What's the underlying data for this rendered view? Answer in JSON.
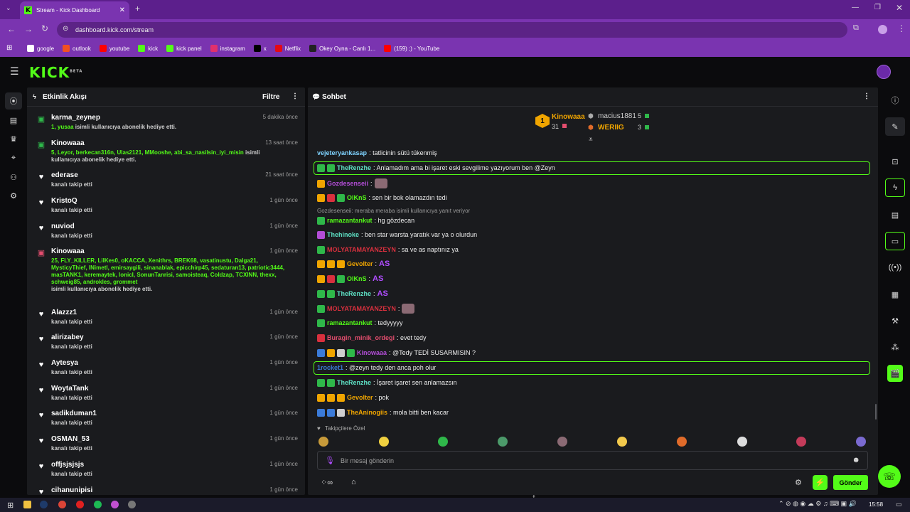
{
  "browser": {
    "tab_title": "Stream - Kick Dashboard",
    "url": "dashboard.kick.com/stream",
    "bookmarks": [
      {
        "label": "google",
        "color": "#ffffff"
      },
      {
        "label": "outlook",
        "color": "#f25022"
      },
      {
        "label": "youtube",
        "color": "#ff0000"
      },
      {
        "label": "kick",
        "color": "#53fc18"
      },
      {
        "label": "kick panel",
        "color": "#53fc18"
      },
      {
        "label": "instagram",
        "color": "#e1306c"
      },
      {
        "label": "x",
        "color": "#000000"
      },
      {
        "label": "Netflix",
        "color": "#e50914"
      },
      {
        "label": "Okey Oyna - Canlı 1...",
        "color": "#222222"
      },
      {
        "label": "(159) ;) - YouTube",
        "color": "#ff0000"
      }
    ]
  },
  "app": {
    "logo": "KICK",
    "logo_badge": "BETA"
  },
  "activity": {
    "title": "Etkinlik Akışı",
    "filter_label": "Filtre",
    "events": [
      {
        "icon": "gift-icon",
        "name": "karma_zeynep",
        "time": "5 dakika önce",
        "highlight": "1, yusaa",
        "text": " isimli kullanıcıya abonelik hediye etti."
      },
      {
        "icon": "gift-icon",
        "name": "Kinowaaa",
        "time": "13 saat önce",
        "highlight": "5, Leyor, berkecan316n, Ulas2121, MMooshe, abi_sa_nasilsin_iyi_misin",
        "text": " isimli kullanıcıya abonelik hediye etti."
      },
      {
        "icon": "heart-icon",
        "name": "ederase",
        "time": "21 saat önce",
        "highlight": "",
        "text": "kanalı takip etti"
      },
      {
        "icon": "heart-icon",
        "name": "KristoQ",
        "time": "1 gün önce",
        "highlight": "",
        "text": "kanalı takip etti"
      },
      {
        "icon": "heart-icon",
        "name": "nuviod",
        "time": "1 gün önce",
        "highlight": "",
        "text": "kanalı takip etti"
      },
      {
        "icon": "gift-icon",
        "name": "Kinowaaa",
        "time": "1 gün önce",
        "highlight": "25, FLY_KILLER, LilKes0, oKACCA, Xenithrs, BREK68, vasatinustu, Dalga21, MysticyThief, INimetI, emirsaygili, sinanablak, epicchirp45, sedaturan13, patriotic3444, masTANK1, keremaytek, lonicI, SonunTanrisi, samoisteaq, Coldzap, TCXINN, thexx, schweig85, androkles, grommet",
        "text": "isimli kullanıcıya abonelik hediye etti."
      },
      {
        "icon": "heart-icon",
        "name": "Alazzz1",
        "time": "1 gün önce",
        "highlight": "",
        "text": "kanalı takip etti"
      },
      {
        "icon": "heart-icon",
        "name": "alirizabey",
        "time": "1 gün önce",
        "highlight": "",
        "text": "kanalı takip etti"
      },
      {
        "icon": "heart-icon",
        "name": "Aytesya",
        "time": "1 gün önce",
        "highlight": "",
        "text": "kanalı takip etti"
      },
      {
        "icon": "heart-icon",
        "name": "WoytaTank",
        "time": "1 gün önce",
        "highlight": "",
        "text": "kanalı takip etti"
      },
      {
        "icon": "heart-icon",
        "name": "sadikduman1",
        "time": "1 gün önce",
        "highlight": "",
        "text": "kanalı takip etti"
      },
      {
        "icon": "heart-icon",
        "name": "OSMAN_53",
        "time": "1 gün önce",
        "highlight": "",
        "text": "kanalı takip etti"
      },
      {
        "icon": "heart-icon",
        "name": "offjsjsjsjs",
        "time": "1 gün önce",
        "highlight": "",
        "text": "kanalı takip etti"
      },
      {
        "icon": "heart-icon",
        "name": "cihanunipisi",
        "time": "1 gün önce",
        "highlight": "",
        "text": ""
      }
    ]
  },
  "chat": {
    "title": "Sohbet",
    "leaderboard": {
      "first": {
        "rank": "1",
        "name": "Kinowaaa",
        "count": "31"
      },
      "second": {
        "name": "macius1881",
        "count": "5"
      },
      "third": {
        "name": "WERIIG",
        "count": "3"
      }
    },
    "messages": [
      {
        "user": "vejeteryankasap",
        "color": "#7fd3ff",
        "badges": [],
        "text": ": tatlicinin sütü tükenmiş",
        "boxed": false,
        "emote": ""
      },
      {
        "user": "TheRenzhe",
        "color": "#5ee0c4",
        "badges": [
          "bg",
          "bg"
        ],
        "text": ": Anlamadım ama bi işaret eski sevgilime yazıyorum ben @Zeyn",
        "boxed": true,
        "emote": ""
      },
      {
        "user": "Gozdesenseii",
        "color": "#b24dd6",
        "badges": [
          "by"
        ],
        "text": ":",
        "boxed": false,
        "emote": "img"
      },
      {
        "user": "OlKnS",
        "color": "#53fc18",
        "badges": [
          "by",
          "br",
          "bg"
        ],
        "text": ": sen bir bok olamazdın tedi",
        "boxed": false,
        "emote": ""
      },
      {
        "user": "ramazantankut",
        "color": "#53fc18",
        "badges": [
          "bg"
        ],
        "text": ": hg gözdecan",
        "boxed": false,
        "emote": "",
        "reply": "Gozdesenseii: meraba meraba isimli kullanıcıya yanıt veriyor"
      },
      {
        "user": "Thehinoke",
        "color": "#5ee0c4",
        "badges": [
          "bp"
        ],
        "text": ": ben star warsta yaratık var ya o olurdun",
        "boxed": false,
        "emote": ""
      },
      {
        "user": "MOLYATAMAYANZEYN",
        "color": "#d9303e",
        "badges": [
          "bg"
        ],
        "text": ": sa ve as naptınız ya",
        "boxed": false,
        "emote": ""
      },
      {
        "user": "Gevolter",
        "color": "#f0a500",
        "badges": [
          "by",
          "by",
          "by"
        ],
        "text": ":",
        "boxed": false,
        "emote": "AS"
      },
      {
        "user": "OlKnS",
        "color": "#53fc18",
        "badges": [
          "by",
          "br",
          "bg"
        ],
        "text": ":",
        "boxed": false,
        "emote": "AS"
      },
      {
        "user": "TheRenzhe",
        "color": "#5ee0c4",
        "badges": [
          "bg",
          "bg"
        ],
        "text": ":",
        "boxed": false,
        "emote": "AS"
      },
      {
        "user": "MOLYATAMAYANZEYN",
        "color": "#d9303e",
        "badges": [
          "bg"
        ],
        "text": ":",
        "boxed": false,
        "emote": "img"
      },
      {
        "user": "ramazantankut",
        "color": "#53fc18",
        "badges": [
          "bg"
        ],
        "text": ": tedyyyyy",
        "boxed": false,
        "emote": ""
      },
      {
        "user": "Buragin_minik_ordegi",
        "color": "#e34d6e",
        "badges": [
          "br"
        ],
        "text": ": evet tedy",
        "boxed": false,
        "emote": ""
      },
      {
        "user": "Kinowaaa",
        "color": "#b24dd6",
        "badges": [
          "bb",
          "by",
          "bw",
          "bg"
        ],
        "text": ": @Tedy TEDİ SUSARMISIN ?",
        "boxed": false,
        "emote": ""
      },
      {
        "user": "1rocket1",
        "color": "#3b7bd9",
        "badges": [],
        "text": ": @zeyn tedy den anca poh olur",
        "boxed": true,
        "emote": ""
      },
      {
        "user": "TheRenzhe",
        "color": "#5ee0c4",
        "badges": [
          "bg",
          "bg"
        ],
        "text": ": İşaret işaret sen anlamazsın",
        "boxed": false,
        "emote": ""
      },
      {
        "user": "Gevolter",
        "color": "#f0a500",
        "badges": [
          "by",
          "by",
          "by"
        ],
        "text": ": pok",
        "boxed": false,
        "emote": ""
      },
      {
        "user": "TheAninogiis",
        "color": "#f0a500",
        "badges": [
          "bb",
          "bb",
          "bw"
        ],
        "text": ": mola bitti ben kacar",
        "boxed": false,
        "emote": ""
      }
    ],
    "followers_label": "Takipçilere Özel",
    "input_placeholder": "Bir mesaj gönderin",
    "send_label": "Gönder"
  },
  "taskbar": {
    "time": "15:58"
  }
}
